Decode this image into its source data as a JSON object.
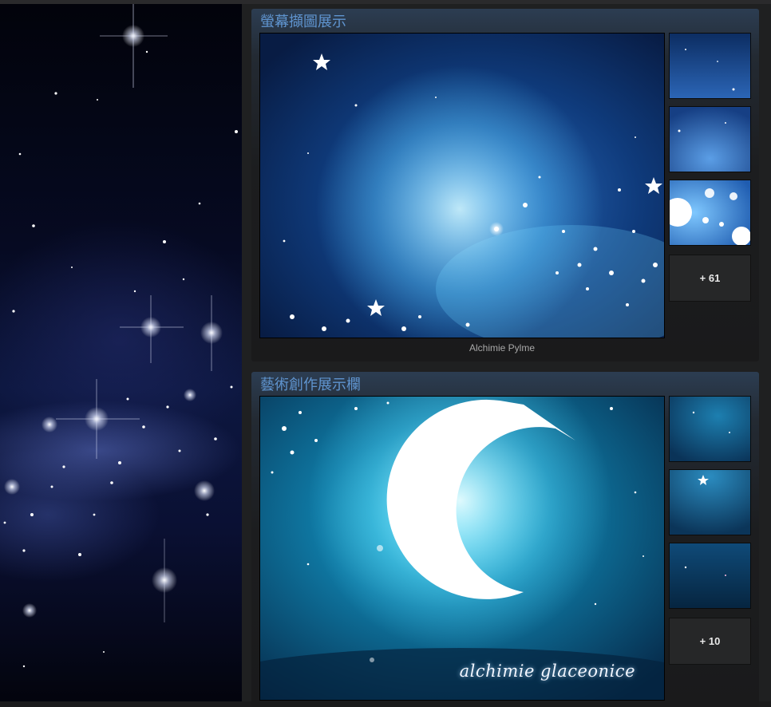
{
  "screenshot_showcase": {
    "title": "螢幕擷圖展示",
    "caption": "Alchimie Pylme",
    "more_count": "+ 61"
  },
  "artwork_showcase": {
    "title": "藝術創作展示欄",
    "signature": "alchimie glaceonice",
    "more_count": "+ 10"
  },
  "colors": {
    "title_blue": "#5f94cf",
    "panel_bg": "#1f2021",
    "moon_glow": "#9fe8ff"
  },
  "icons": [
    "star-sparkle",
    "moon-crescent"
  ]
}
